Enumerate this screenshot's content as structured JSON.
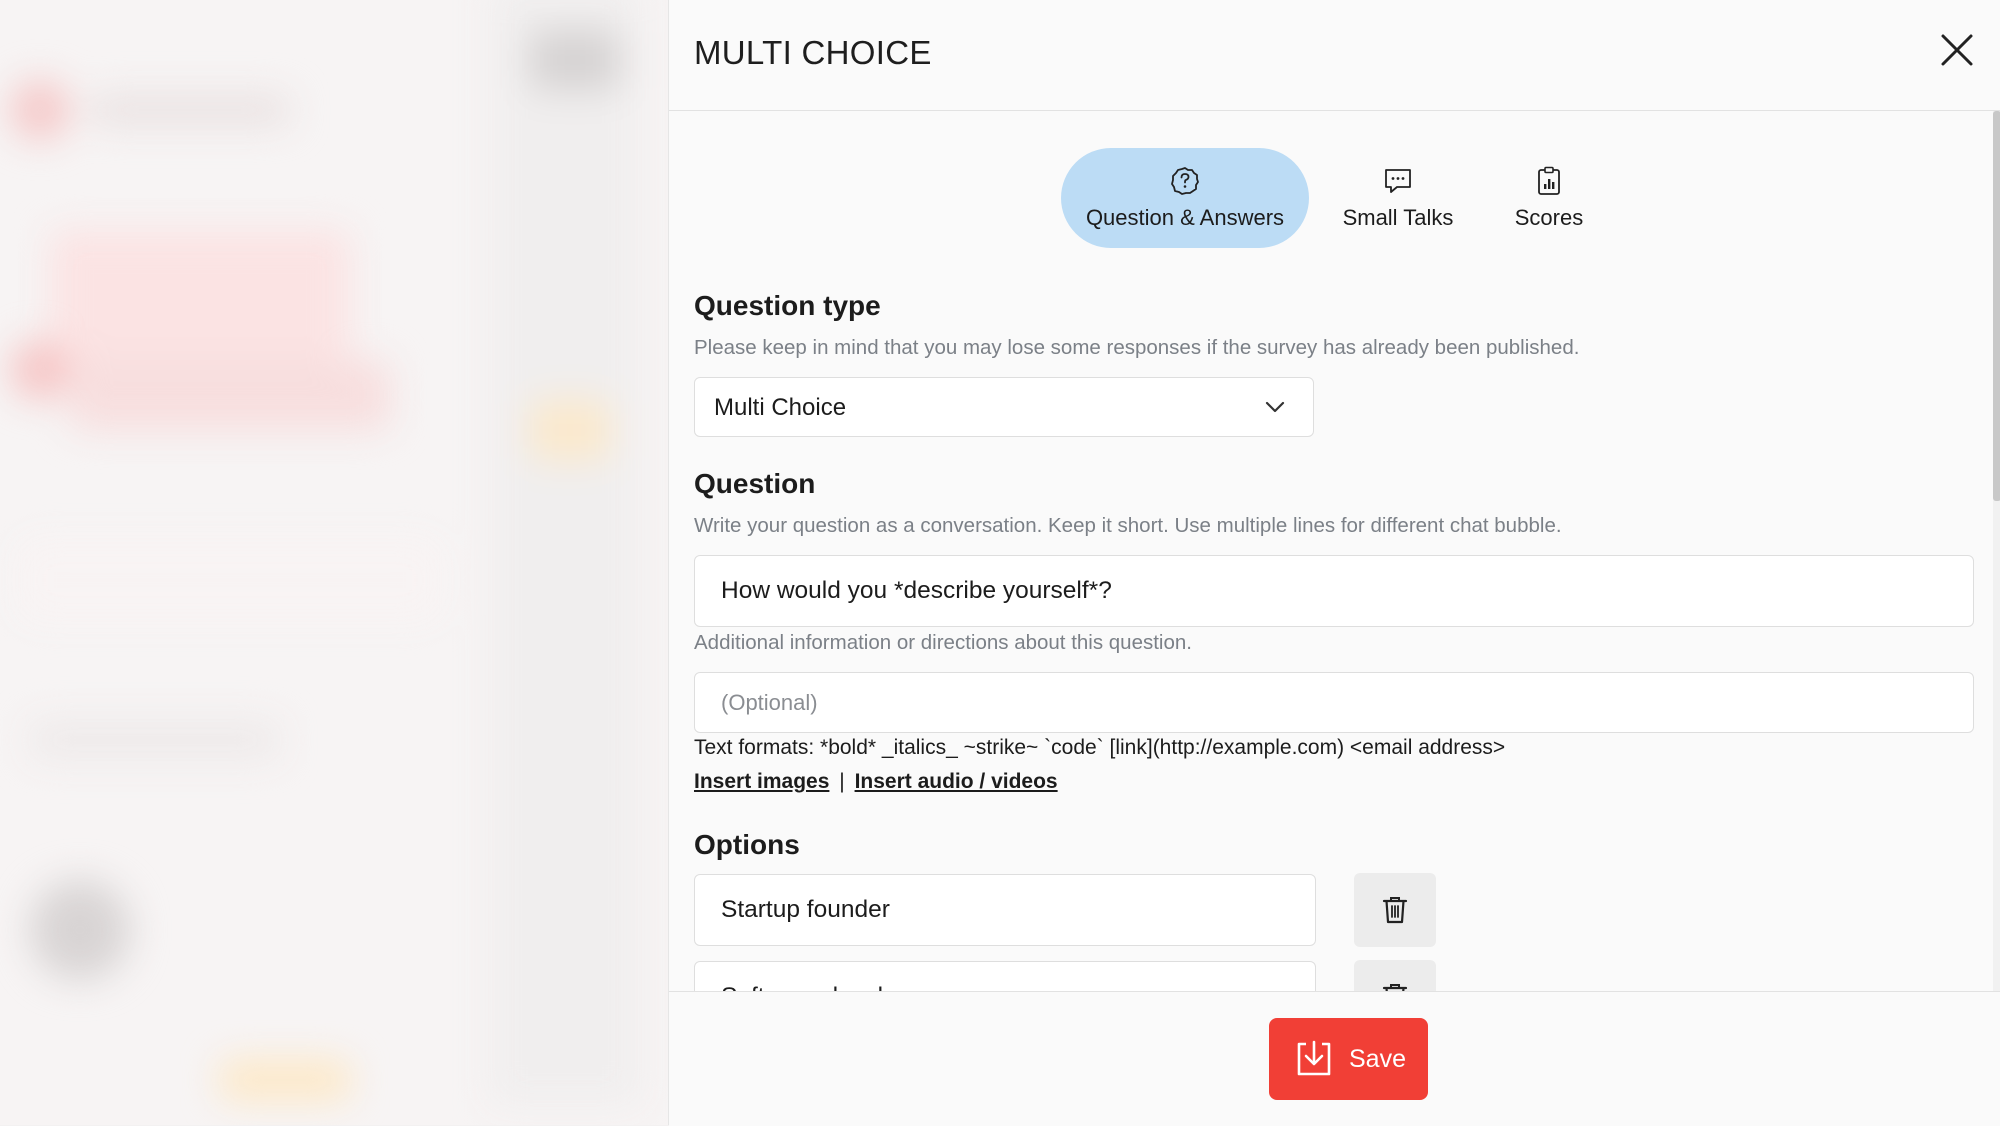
{
  "drawer": {
    "title": "MULTI CHOICE"
  },
  "tabs": [
    {
      "label": "Question & Answers",
      "icon": "question-circle-icon",
      "active": true
    },
    {
      "label": "Small Talks",
      "icon": "chat-bubble-icon",
      "active": false
    },
    {
      "label": "Scores",
      "icon": "clipboard-chart-icon",
      "active": false
    }
  ],
  "question_type": {
    "label": "Question type",
    "hint": "Please keep in mind that you may lose some responses if the survey has already been published.",
    "selected": "Multi Choice"
  },
  "question": {
    "label": "Question",
    "hint": "Write your question as a conversation. Keep it short. Use multiple lines for different chat bubble.",
    "value": "How would you *describe yourself*?",
    "extra_hint": "Additional information or directions about this question.",
    "extra_placeholder": "(Optional)",
    "formats": "Text formats: *bold* _italics_ ~strike~ `code` [link](http://example.com) <email address>",
    "insert_images": "Insert images",
    "separator": "|",
    "insert_media": "Insert audio / videos"
  },
  "options": {
    "label": "Options",
    "items": [
      "Startup founder",
      "Software developer"
    ]
  },
  "footer": {
    "save_label": "Save"
  },
  "colors": {
    "accent": "#f13f36",
    "active_tab": "#bcdcf5"
  }
}
